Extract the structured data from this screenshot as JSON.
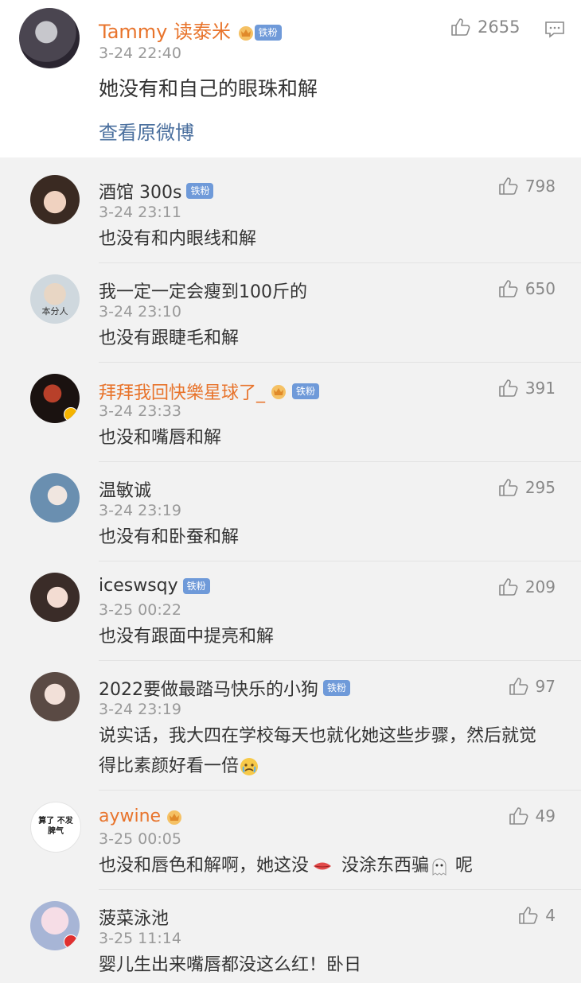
{
  "top": {
    "username": "Tammy 读泰米",
    "badge": "铁粉",
    "time": "3-24 22:40",
    "text": "她没有和自己的眼珠和解",
    "likes": "2655",
    "link": "查看原微博"
  },
  "replies": [
    {
      "username": "酒馆 300s",
      "badge": "铁粉",
      "time": "3-24 23:11",
      "text": "也没有和内眼线和解",
      "likes": "798"
    },
    {
      "username": "我一定一定会瘦到100斤的",
      "avatar_caption": "本分人",
      "time": "3-24 23:10",
      "text": "也没有跟睫毛和解",
      "likes": "650"
    },
    {
      "username": "拜拜我回快樂星球了_",
      "badge": "铁粉",
      "time": "3-24 23:33",
      "text": "也没和嘴唇和解",
      "likes": "391"
    },
    {
      "username": "温敏诚",
      "time": "3-24 23:19",
      "text": "也没有和卧蚕和解",
      "likes": "295"
    },
    {
      "username": "iceswsqy",
      "badge": "铁粉",
      "time": "3-25 00:22",
      "text": "也没有跟面中提亮和解",
      "likes": "209"
    },
    {
      "username": "2022要做最踏马快乐的小狗",
      "badge": "铁粉",
      "time": "3-24 23:19",
      "text": "说实话，我大四在学校每天也就化她这些步骤，然后就觉得比素颜好看一倍",
      "likes": "97"
    },
    {
      "username": "aywine",
      "avatar_caption": "算了 不发脾气",
      "time": "3-25 00:05",
      "text_a": "也没和唇色和解啊，她这没",
      "text_b": "没涂东西骗",
      "text_c": "呢",
      "likes": "49"
    },
    {
      "username": "菠菜泳池",
      "time": "3-25 11:14",
      "text": "婴儿生出来嘴唇都没这么红！卧日",
      "likes": "4"
    }
  ],
  "colors": {
    "orange_name": "#e8742c",
    "badge_bg": "#6f9ad9",
    "link": "#4a6f9e",
    "background": "#f2f2f2"
  }
}
